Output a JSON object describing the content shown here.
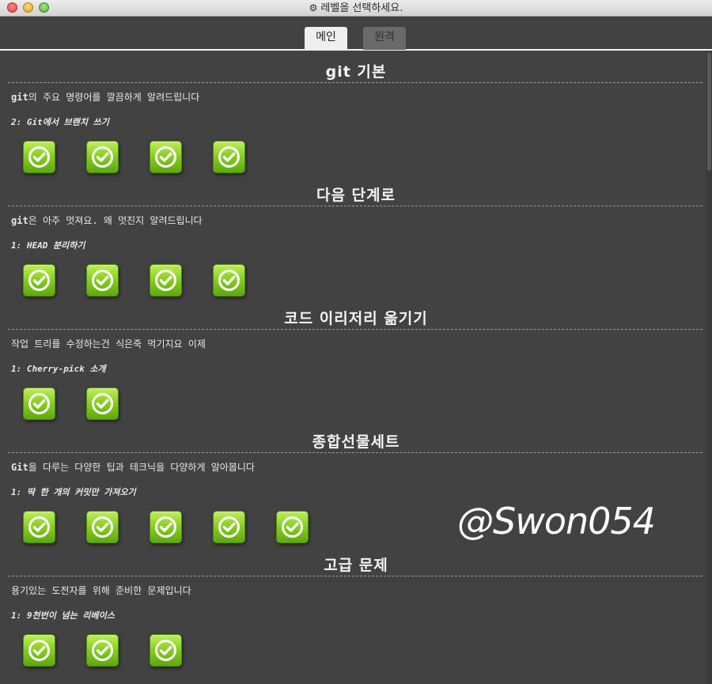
{
  "window": {
    "title": "레벨을 선택하세요.",
    "gear_icon": "⚙"
  },
  "tabs": [
    {
      "label": "메인",
      "active": true
    },
    {
      "label": "원격",
      "active": false
    }
  ],
  "sections": [
    {
      "title": "git 기본",
      "desc_bold": "git",
      "desc_rest": "의 주요 명령어를 깔끔하게 알려드립니다",
      "level_name": "2: Git에서 브랜치 쓰기",
      "level_count": 4
    },
    {
      "title": "다음 단계로",
      "desc_bold": "git",
      "desc_rest": "은 아주 멋져요. 왜 멋진지 알려드립니다",
      "level_name": "1: HEAD 분리하기",
      "level_count": 4
    },
    {
      "title": "코드 이리저리 옮기기",
      "desc_bold": "",
      "desc_rest": "작업 트리를 수정하는건 식은죽 먹기지요 이제",
      "level_name": "1: Cherry-pick 소개",
      "level_count": 2
    },
    {
      "title": "종합선물세트",
      "desc_bold": "Git",
      "desc_rest": "을 다루는 다양한 팁과 테크닉을 다양하게 알아봅니다",
      "level_name": "1: 딱 한 개의 커밋만 가져오기",
      "level_count": 5
    },
    {
      "title": "고급 문제",
      "desc_bold": "",
      "desc_rest": "용기있는 도전자를 위해 준비한 문제입니다",
      "level_name": "1: 9천번이 넘는 리베이스",
      "level_count": 3
    }
  ],
  "level_status": "completed",
  "level_icon": "checkmark-circle-icon",
  "colors": {
    "background": "#424242",
    "level_button_green": "#86cc1f",
    "text": "#e8e8e8"
  },
  "watermark": "@Swon054"
}
